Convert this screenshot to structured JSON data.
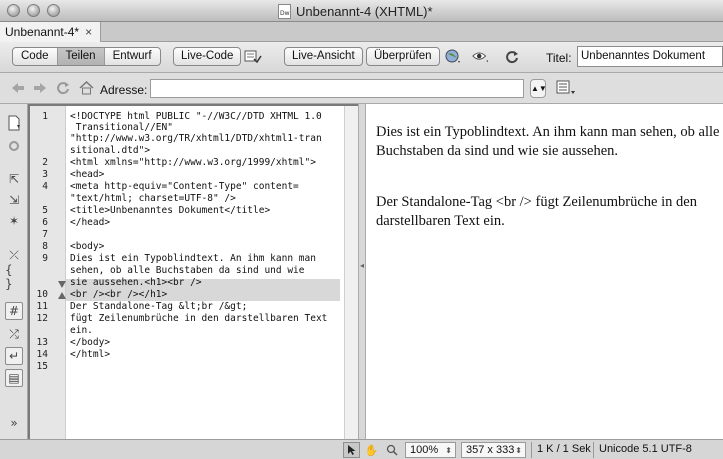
{
  "window": {
    "title": "Unbenannt-4 (XHTML)*"
  },
  "document_tab": {
    "label": "Unbenannt-4*",
    "close_glyph": "×"
  },
  "toolbar": {
    "view_buttons": [
      "Code",
      "Teilen",
      "Entwurf"
    ],
    "live_code": "Live-Code",
    "live_view": "Live-Ansicht",
    "check": "Überprüfen",
    "title_label": "Titel:",
    "title_value": "Unbenanntes Dokument"
  },
  "address": {
    "label": "Adresse:",
    "value": ""
  },
  "code": {
    "line_numbers": [
      "1",
      "2",
      "3",
      "4",
      "5",
      "6",
      "7",
      "8",
      "9",
      "10",
      "11",
      "12",
      "13",
      "14",
      "15"
    ],
    "lines": [
      "<!DOCTYPE html PUBLIC \"-//W3C//DTD XHTML 1.0",
      " Transitional//EN\"",
      "\"http://www.w3.org/TR/xhtml1/DTD/xhtml1-tran",
      "sitional.dtd\">",
      "<html xmlns=\"http://www.w3.org/1999/xhtml\">",
      "<head>",
      "<meta http-equiv=\"Content-Type\" content=",
      "\"text/html; charset=UTF-8\" />",
      "<title>Unbenanntes Dokument</title>",
      "</head>",
      "",
      "<body>",
      "Dies ist ein Typoblindtext. An ihm kann man",
      "sehen, ob alle Buchstaben da sind und wie",
      "sie aussehen.<h1><br />",
      "<br /><br /></h1>",
      "Der Standalone-Tag &lt;br /&gt;",
      "fügt Zeilenumbrüche in den darstellbaren Text",
      "ein.",
      "</body>",
      "</html>"
    ]
  },
  "design": {
    "paragraph1": "Dies ist ein Typoblindtext. An ihm kann man sehen, ob alle Buchstaben da sind und wie sie aussehen.",
    "paragraph2": "Der Standalone-Tag <br /> fügt Zeilenumbrüche in den darstellbaren Text ein."
  },
  "status": {
    "zoom": "100%",
    "dimensions": "357 x 333",
    "size": "1 K / 1 Sek",
    "encoding": "Unicode 5.1 UTF-8"
  },
  "icons": {
    "view_options": "view-options-icon",
    "browser_preview": "globe-icon",
    "visual_aids": "eye-icon",
    "refresh": "refresh-icon"
  }
}
